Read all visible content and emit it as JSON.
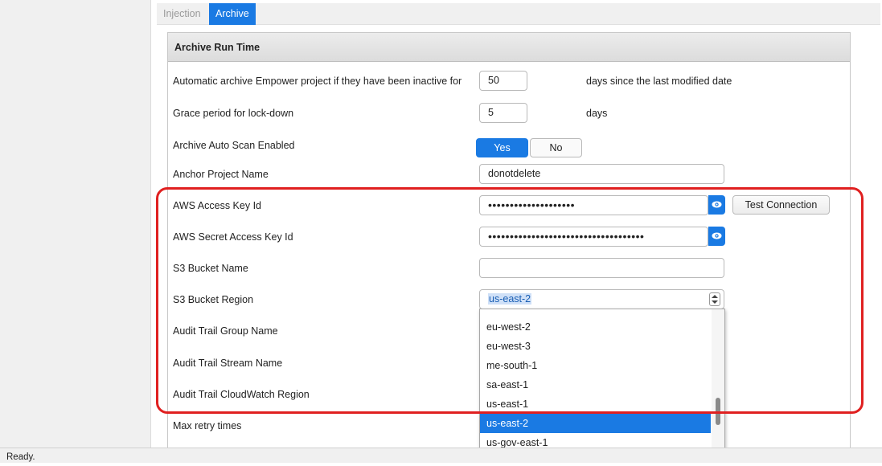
{
  "tabs": [
    {
      "label": "Injection",
      "active": false
    },
    {
      "label": "Archive",
      "active": true
    }
  ],
  "section": {
    "title": "Archive Run Time"
  },
  "fields": {
    "inactive_days": {
      "label": "Automatic archive Empower project if they have been inactive for",
      "value": "50",
      "suffix": "days since the last modified date"
    },
    "grace_period": {
      "label": "Grace period for lock-down",
      "value": "5",
      "suffix": "days"
    },
    "auto_scan": {
      "label": "Archive Auto Scan Enabled",
      "yes_label": "Yes",
      "no_label": "No",
      "selected": "Yes"
    },
    "anchor_project": {
      "label": "Anchor Project Name",
      "value": "donotdelete"
    },
    "aws_access_key": {
      "label": "AWS Access Key Id",
      "value": "••••••••••••••••••••",
      "test_button": "Test Connection"
    },
    "aws_secret_key": {
      "label": "AWS Secret Access Key Id",
      "value": "••••••••••••••••••••••••••••••••••••"
    },
    "s3_bucket_name": {
      "label": "S3 Bucket Name",
      "value": ""
    },
    "s3_bucket_region": {
      "label": "S3 Bucket Region",
      "value": "us-east-2"
    },
    "audit_group": {
      "label": "Audit Trail Group Name"
    },
    "audit_stream": {
      "label": "Audit Trail Stream Name"
    },
    "audit_region": {
      "label": "Audit Trail CloudWatch Region"
    },
    "max_retry": {
      "label": "Max retry times"
    }
  },
  "region_dropdown": {
    "options": [
      "eu-west-2",
      "eu-west-3",
      "me-south-1",
      "sa-east-1",
      "us-east-1",
      "us-east-2",
      "us-gov-east-1"
    ],
    "selected": "us-east-2"
  },
  "status_bar": {
    "text": "Ready."
  },
  "colors": {
    "accent": "#1a7ae3",
    "highlight_border": "#e02020"
  },
  "icons": {
    "eye": "eye-icon",
    "spinner": "chevron-up-down-icon"
  }
}
